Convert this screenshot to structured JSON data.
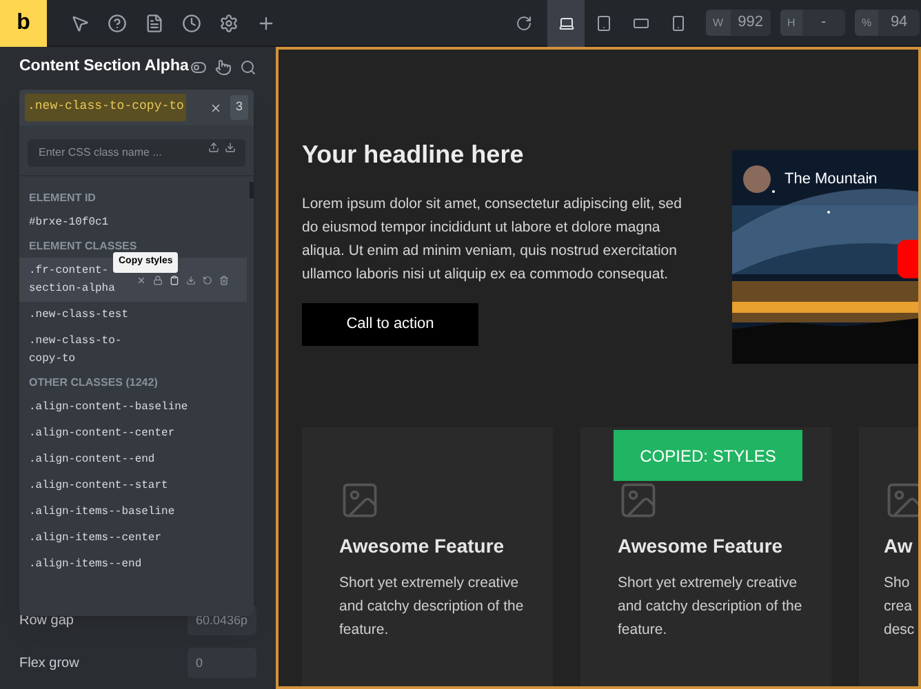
{
  "toolbar": {
    "logo": "b",
    "devices": [
      {
        "kind": "desktop",
        "selected": true
      },
      {
        "kind": "tablet",
        "selected": false
      },
      {
        "kind": "landscape",
        "selected": false
      },
      {
        "kind": "phone",
        "selected": false
      }
    ],
    "fields": [
      {
        "label": "W",
        "value": "992"
      },
      {
        "label": "H",
        "value": "-"
      },
      {
        "label": "%",
        "value": "94"
      }
    ]
  },
  "panel": {
    "title": "Content Section Alpha",
    "properties": [
      {
        "label": "Row gap",
        "placeholder": "60.0436p"
      },
      {
        "label": "Flex grow",
        "placeholder": "0"
      }
    ]
  },
  "class_dropdown": {
    "active_class": ".new-class-to-copy-to",
    "count": "3",
    "search_placeholder": "Enter CSS class name ...",
    "tooltip": "Copy styles",
    "sections": [
      {
        "heading": "ELEMENT ID",
        "items": [
          {
            "name": "#brxe-10f0c1",
            "hovered": false
          }
        ]
      },
      {
        "heading": "ELEMENT CLASSES",
        "items": [
          {
            "name": ".fr-content-section-alpha",
            "hovered": true
          },
          {
            "name": ".new-class-test",
            "hovered": false
          },
          {
            "name": ".new-class-to-copy-to",
            "hovered": false
          }
        ]
      },
      {
        "heading": "OTHER CLASSES (1242)",
        "items": [
          {
            "name": ".align-content--baseline",
            "hovered": false
          },
          {
            "name": ".align-content--center",
            "hovered": false
          },
          {
            "name": ".align-content--end",
            "hovered": false
          },
          {
            "name": ".align-content--start",
            "hovered": false
          },
          {
            "name": ".align-items--baseline",
            "hovered": false
          },
          {
            "name": ".align-items--center",
            "hovered": false
          },
          {
            "name": ".align-items--end",
            "hovered": false
          }
        ]
      }
    ]
  },
  "canvas": {
    "headline": "Your headline here",
    "body": "Lorem ipsum dolor sit amet, consectetur adipiscing elit, sed do eiusmod tempor incididunt ut labore et dolore magna aliqua. Ut enim ad minim veniam, quis nostrud exercitation ullamco laboris nisi ut aliquip ex ea commodo consequat.",
    "button": "Call to action",
    "video": {
      "title": "The Mountain"
    },
    "features": [
      {
        "title": "Awesome Feature",
        "text": "Short yet extremely creative and catchy description of the feature."
      },
      {
        "title": "Awesome Feature",
        "text": "Short yet extremely creative and catchy description of the feature."
      },
      {
        "title": "Aw",
        "text": "Sho crea desc"
      }
    ],
    "toast": "COPIED: STYLES"
  }
}
